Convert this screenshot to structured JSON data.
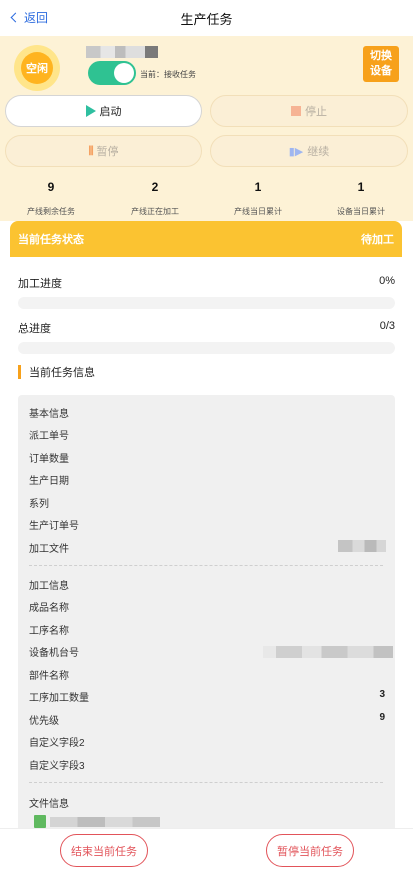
{
  "nav": {
    "back_label": "返回",
    "title": "生产任务"
  },
  "device": {
    "status": "空闲",
    "mode_label": "当前：接收任务",
    "switch_label_1": "切换",
    "switch_label_2": "设备"
  },
  "controls": {
    "start": "启动",
    "stop": "停止",
    "pause": "暂停",
    "resume": "继续"
  },
  "stats": [
    {
      "value": "9",
      "label": "产线剩余任务"
    },
    {
      "value": "2",
      "label": "产线正在加工"
    },
    {
      "value": "1",
      "label": "产线当日累计"
    },
    {
      "value": "1",
      "label": "设备当日累计"
    }
  ],
  "task": {
    "status_title": "当前任务状态",
    "status_value": "待加工",
    "progress_label": "加工进度",
    "progress_value": "0%",
    "total_label": "总进度",
    "total_value": "0/3",
    "info_title": "当前任务信息"
  },
  "info": {
    "basic_header": "基本信息",
    "dispatch_no": "派工单号",
    "order_qty": "订单数量",
    "prod_date": "生产日期",
    "series": "系列",
    "prod_order_no": "生产订单号",
    "process_file": "加工文件",
    "process_header": "加工信息",
    "product_name": "成品名称",
    "step_name": "工序名称",
    "machine_no": "设备机台号",
    "part_name": "部件名称",
    "step_qty_label": "工序加工数量",
    "step_qty_value": "3",
    "priority_label": "优先级",
    "priority_value": "9",
    "custom2": "自定义字段2",
    "custom3": "自定义字段3",
    "file_header": "文件信息"
  },
  "bottom": {
    "end_task": "结束当前任务",
    "pause_task": "暂停当前任务"
  },
  "colors": {
    "accent": "#fbc331",
    "switch": "#f7a11b",
    "toggle": "#2fc292",
    "danger": "#e2545a"
  }
}
